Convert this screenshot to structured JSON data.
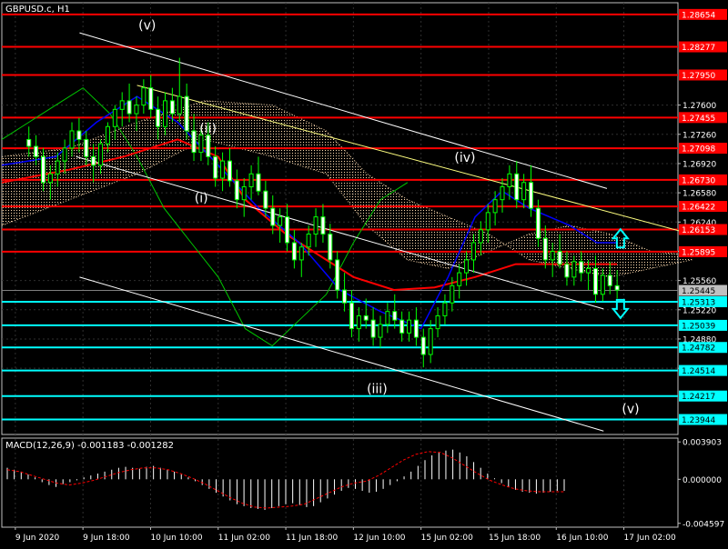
{
  "window": {
    "symbol_title": "GBPUSD.c, H1"
  },
  "indicator": {
    "macd_label": "MACD(12,26,9) -0.001183 -0.001282"
  },
  "colors": {
    "background": "#000000",
    "grid": "#2f2f2f",
    "candle": "#00ff00",
    "resistance": "#ff0000",
    "support": "#00ffff",
    "channel": "#ffffff",
    "trendline": "#ffff80",
    "ichimoku_cloud": "#ffdcb0",
    "kijun": "#ff0000",
    "tenkan": "#0000ff",
    "chikou": "#00c800",
    "macd_hist": "#ffffff",
    "macd_signal": "#ff0000",
    "badge_red": "#ff0000",
    "badge_cyan": "#00ffff",
    "badge_current": "#c0c0c0",
    "arrow_up": "#00ffff",
    "arrow_down": "#00ffff"
  },
  "chart_data": {
    "type": "candlestick",
    "symbol": "GBPUSD.c",
    "timeframe": "H1",
    "ylim": [
      1.2377,
      1.2879
    ],
    "xlim": [
      0,
      100
    ],
    "y_ticks": [
      "1.27600",
      "1.27260",
      "1.26920",
      "1.26580",
      "1.26240",
      "1.25900",
      "1.25560",
      "1.25220",
      "1.24880",
      "1.24540"
    ],
    "x_ticks": [
      {
        "label": "9 Jun 2020",
        "x": 2
      },
      {
        "label": "9 Jun 18:00",
        "x": 12
      },
      {
        "label": "10 Jun 10:00",
        "x": 22
      },
      {
        "label": "11 Jun 02:00",
        "x": 32
      },
      {
        "label": "11 Jun 18:00",
        "x": 42
      },
      {
        "label": "12 Jun 10:00",
        "x": 52
      },
      {
        "label": "15 Jun 02:00",
        "x": 62
      },
      {
        "label": "15 Jun 18:00",
        "x": 72
      },
      {
        "label": "16 Jun 10:00",
        "x": 82
      },
      {
        "label": "17 Jun 02:00",
        "x": 92
      }
    ],
    "current_price": "1.25445",
    "resistance_levels": [
      "1.28654",
      "1.28277",
      "1.27950",
      "1.27455",
      "1.27098",
      "1.26730",
      "1.26422",
      "1.26153",
      "1.25895"
    ],
    "support_levels": [
      "1.25313",
      "1.25039",
      "1.24782",
      "1.24514",
      "1.24217",
      "1.23944"
    ],
    "wave_labels": [
      {
        "text": "(v)",
        "x": 21.5,
        "y": 1.2848
      },
      {
        "text": "(ii)",
        "x": 30.5,
        "y": 1.2728
      },
      {
        "text": "(i)",
        "x": 29.5,
        "y": 1.2647
      },
      {
        "text": "(iv)",
        "x": 68.5,
        "y": 1.2694
      },
      {
        "text": "(iii)",
        "x": 55.5,
        "y": 1.2425
      },
      {
        "text": "(v)",
        "x": 93.0,
        "y": 1.2402
      }
    ],
    "channel_lines": [
      {
        "x1": 11.5,
        "y1": 1.2844,
        "x2": 89.5,
        "y2": 1.2663
      },
      {
        "x1": 11.0,
        "y1": 1.27,
        "x2": 89.0,
        "y2": 1.2523
      },
      {
        "x1": 11.5,
        "y1": 1.256,
        "x2": 89.0,
        "y2": 1.2381
      }
    ],
    "trend_line": {
      "x1": 20.0,
      "y1": 1.2783,
      "x2": 101.5,
      "y2": 1.2611
    },
    "signal_arrows": [
      {
        "direction": "up",
        "x": 91.5,
        "y": 1.2605
      },
      {
        "direction": "down",
        "x": 91.5,
        "y": 1.2523
      }
    ],
    "candles": [
      [
        1.272,
        1.2735,
        1.27,
        1.2712
      ],
      [
        1.2712,
        1.2725,
        1.269,
        1.27
      ],
      [
        1.27,
        1.271,
        1.266,
        1.267
      ],
      [
        1.267,
        1.269,
        1.265,
        1.268
      ],
      [
        1.268,
        1.2705,
        1.2665,
        1.2695
      ],
      [
        1.2695,
        1.272,
        1.268,
        1.271
      ],
      [
        1.271,
        1.274,
        1.27,
        1.273
      ],
      [
        1.273,
        1.2745,
        1.2705,
        1.272
      ],
      [
        1.272,
        1.273,
        1.269,
        1.27
      ],
      [
        1.27,
        1.2715,
        1.267,
        1.269
      ],
      [
        1.269,
        1.272,
        1.268,
        1.2715
      ],
      [
        1.2715,
        1.274,
        1.2705,
        1.2735
      ],
      [
        1.2735,
        1.276,
        1.272,
        1.2755
      ],
      [
        1.2755,
        1.2775,
        1.2735,
        1.2765
      ],
      [
        1.2765,
        1.2785,
        1.274,
        1.275
      ],
      [
        1.275,
        1.277,
        1.273,
        1.276
      ],
      [
        1.276,
        1.279,
        1.275,
        1.278
      ],
      [
        1.278,
        1.2795,
        1.2745,
        1.2755
      ],
      [
        1.2755,
        1.277,
        1.272,
        1.2735
      ],
      [
        1.2735,
        1.2775,
        1.2725,
        1.2765
      ],
      [
        1.2765,
        1.278,
        1.274,
        1.275
      ],
      [
        1.275,
        1.2815,
        1.274,
        1.277
      ],
      [
        1.277,
        1.2785,
        1.272,
        1.273
      ],
      [
        1.273,
        1.275,
        1.2695,
        1.2705
      ],
      [
        1.2705,
        1.2735,
        1.2695,
        1.2725
      ],
      [
        1.2725,
        1.274,
        1.269,
        1.27
      ],
      [
        1.27,
        1.2712,
        1.2665,
        1.2675
      ],
      [
        1.2675,
        1.2705,
        1.266,
        1.2695
      ],
      [
        1.2695,
        1.271,
        1.2665,
        1.2672
      ],
      [
        1.2672,
        1.2685,
        1.264,
        1.265
      ],
      [
        1.265,
        1.2675,
        1.263,
        1.2665
      ],
      [
        1.2665,
        1.269,
        1.265,
        1.268
      ],
      [
        1.268,
        1.27,
        1.2655,
        1.266
      ],
      [
        1.266,
        1.2672,
        1.263,
        1.264
      ],
      [
        1.264,
        1.2655,
        1.261,
        1.262
      ],
      [
        1.262,
        1.264,
        1.26,
        1.263
      ],
      [
        1.263,
        1.2645,
        1.259,
        1.26
      ],
      [
        1.26,
        1.2615,
        1.257,
        1.258
      ],
      [
        1.258,
        1.26,
        1.256,
        1.2595
      ],
      [
        1.2595,
        1.262,
        1.2585,
        1.261
      ],
      [
        1.261,
        1.264,
        1.2595,
        1.263
      ],
      [
        1.263,
        1.2645,
        1.26,
        1.261
      ],
      [
        1.261,
        1.2622,
        1.257,
        1.258
      ],
      [
        1.258,
        1.259,
        1.2535,
        1.2545
      ],
      [
        1.2545,
        1.2565,
        1.252,
        1.253
      ],
      [
        1.253,
        1.2545,
        1.249,
        1.25
      ],
      [
        1.25,
        1.2525,
        1.2485,
        1.2515
      ],
      [
        1.2515,
        1.2535,
        1.25,
        1.251
      ],
      [
        1.251,
        1.2525,
        1.248,
        1.249
      ],
      [
        1.249,
        1.2515,
        1.2478,
        1.2505
      ],
      [
        1.2505,
        1.253,
        1.2495,
        1.252
      ],
      [
        1.252,
        1.254,
        1.25,
        1.251
      ],
      [
        1.251,
        1.252,
        1.2485,
        1.2495
      ],
      [
        1.2495,
        1.252,
        1.2485,
        1.251
      ],
      [
        1.251,
        1.2525,
        1.248,
        1.249
      ],
      [
        1.249,
        1.25,
        1.2455,
        1.247
      ],
      [
        1.247,
        1.251,
        1.246,
        1.25
      ],
      [
        1.25,
        1.2525,
        1.249,
        1.2515
      ],
      [
        1.2515,
        1.254,
        1.2505,
        1.253
      ],
      [
        1.253,
        1.256,
        1.252,
        1.255
      ],
      [
        1.255,
        1.2575,
        1.2535,
        1.2565
      ],
      [
        1.2565,
        1.259,
        1.255,
        1.258
      ],
      [
        1.258,
        1.261,
        1.2565,
        1.26
      ],
      [
        1.26,
        1.2625,
        1.2585,
        1.2615
      ],
      [
        1.2615,
        1.2645,
        1.26,
        1.2635
      ],
      [
        1.2635,
        1.266,
        1.262,
        1.265
      ],
      [
        1.265,
        1.2675,
        1.2635,
        1.2665
      ],
      [
        1.2665,
        1.269,
        1.265,
        1.268
      ],
      [
        1.268,
        1.2695,
        1.264,
        1.265
      ],
      [
        1.265,
        1.268,
        1.264,
        1.267
      ],
      [
        1.267,
        1.269,
        1.263,
        1.264
      ],
      [
        1.264,
        1.265,
        1.2595,
        1.2605
      ],
      [
        1.2605,
        1.262,
        1.257,
        1.258
      ],
      [
        1.258,
        1.26,
        1.256,
        1.259
      ],
      [
        1.259,
        1.261,
        1.257,
        1.2575
      ],
      [
        1.2575,
        1.259,
        1.255,
        1.256
      ],
      [
        1.256,
        1.2585,
        1.255,
        1.2578
      ],
      [
        1.2578,
        1.259,
        1.2555,
        1.2565
      ],
      [
        1.2565,
        1.258,
        1.2545,
        1.257
      ],
      [
        1.257,
        1.2585,
        1.253,
        1.254
      ],
      [
        1.254,
        1.257,
        1.2532,
        1.2562
      ],
      [
        1.2562,
        1.2578,
        1.254,
        1.255
      ],
      [
        1.255,
        1.2568,
        1.2535,
        1.2545
      ]
    ],
    "ichimoku": {
      "tenkan": [
        [
          0,
          1.269
        ],
        [
          8,
          1.27
        ],
        [
          14,
          1.274
        ],
        [
          20,
          1.277
        ],
        [
          26,
          1.274
        ],
        [
          32,
          1.269
        ],
        [
          38,
          1.264
        ],
        [
          44,
          1.26
        ],
        [
          50,
          1.2545
        ],
        [
          56,
          1.252
        ],
        [
          62,
          1.25
        ],
        [
          66,
          1.256
        ],
        [
          70,
          1.263
        ],
        [
          74,
          1.266
        ],
        [
          78,
          1.264
        ],
        [
          84,
          1.262
        ],
        [
          88,
          1.26
        ],
        [
          91,
          1.26
        ]
      ],
      "kijun": [
        [
          0,
          1.267
        ],
        [
          10,
          1.2685
        ],
        [
          18,
          1.27
        ],
        [
          26,
          1.272
        ],
        [
          32,
          1.27
        ],
        [
          36,
          1.265
        ],
        [
          42,
          1.261
        ],
        [
          48,
          1.258
        ],
        [
          52,
          1.256
        ],
        [
          58,
          1.2545
        ],
        [
          64,
          1.2548
        ],
        [
          70,
          1.256
        ],
        [
          76,
          1.2575
        ],
        [
          84,
          1.2575
        ],
        [
          91,
          1.2575
        ]
      ],
      "chikou": [
        [
          0,
          1.272
        ],
        [
          4,
          1.274
        ],
        [
          8,
          1.276
        ],
        [
          12,
          1.278
        ],
        [
          16,
          1.275
        ],
        [
          20,
          1.27
        ],
        [
          24,
          1.264
        ],
        [
          28,
          1.26
        ],
        [
          32,
          1.256
        ],
        [
          36,
          1.25
        ],
        [
          40,
          1.248
        ],
        [
          44,
          1.251
        ],
        [
          48,
          1.254
        ],
        [
          52,
          1.26
        ],
        [
          56,
          1.265
        ],
        [
          60,
          1.267
        ]
      ],
      "span_a": [
        [
          0,
          1.262
        ],
        [
          10,
          1.265
        ],
        [
          20,
          1.268
        ],
        [
          30,
          1.272
        ],
        [
          40,
          1.27
        ],
        [
          48,
          1.268
        ],
        [
          54,
          1.262
        ],
        [
          60,
          1.258
        ],
        [
          66,
          1.257
        ],
        [
          72,
          1.259
        ],
        [
          78,
          1.261
        ],
        [
          84,
          1.262
        ],
        [
          90,
          1.261
        ],
        [
          96,
          1.259
        ],
        [
          102,
          1.2585
        ]
      ],
      "span_b": [
        [
          0,
          1.27
        ],
        [
          10,
          1.271
        ],
        [
          20,
          1.274
        ],
        [
          30,
          1.2765
        ],
        [
          40,
          1.276
        ],
        [
          48,
          1.273
        ],
        [
          54,
          1.268
        ],
        [
          60,
          1.265
        ],
        [
          66,
          1.263
        ],
        [
          72,
          1.261
        ],
        [
          78,
          1.258
        ],
        [
          84,
          1.257
        ],
        [
          90,
          1.256
        ],
        [
          96,
          1.257
        ],
        [
          102,
          1.258
        ]
      ]
    },
    "macd": {
      "ylim": [
        -0.005,
        0.0043
      ],
      "y_ticks": [
        "0.003903",
        "0.000000",
        "-0.004597"
      ],
      "histogram": [
        0.0012,
        0.001,
        0.0008,
        0.0005,
        0.0002,
        -0.0003,
        -0.0006,
        -0.0008,
        -0.0005,
        -0.0003,
        -0.0001,
        0.0002,
        0.0004,
        0.0006,
        0.0008,
        0.001,
        0.0012,
        0.0013,
        0.0012,
        0.0011,
        0.0013,
        0.0014,
        0.0012,
        0.001,
        0.0008,
        0.0005,
        0.0002,
        -0.0002,
        -0.0006,
        -0.001,
        -0.0014,
        -0.0018,
        -0.0022,
        -0.0026,
        -0.0028,
        -0.003,
        -0.0031,
        -0.0032,
        -0.003,
        -0.0028,
        -0.0026,
        -0.0025,
        -0.0027,
        -0.0029,
        -0.0028,
        -0.0024,
        -0.002,
        -0.0016,
        -0.0012,
        -0.0009,
        -0.001,
        -0.0012,
        -0.0014,
        -0.0013,
        -0.001,
        -0.0006,
        -0.0002,
        0.0003,
        0.0008,
        0.0014,
        0.002,
        0.0025,
        0.0028,
        0.003,
        0.0031,
        0.0028,
        0.0024,
        0.0018,
        0.0012,
        0.0006,
        0.0001,
        -0.0004,
        -0.0008,
        -0.0011,
        -0.0013,
        -0.0014,
        -0.0015,
        -0.0014,
        -0.0013,
        -0.0012,
        -0.0012
      ],
      "signal": [
        0.001,
        0.0008,
        0.0004,
        0.0,
        -0.0004,
        -0.0006,
        -0.0004,
        -0.0001,
        0.0003,
        0.0007,
        0.001,
        0.0012,
        0.0012,
        0.001,
        0.0006,
        0.0001,
        -0.0005,
        -0.0012,
        -0.0019,
        -0.0025,
        -0.0029,
        -0.003,
        -0.0029,
        -0.0028,
        -0.0026,
        -0.002,
        -0.0014,
        -0.0008,
        -0.0004,
        -0.0002,
        0.0004,
        0.0012,
        0.002,
        0.0026,
        0.0029,
        0.0028,
        0.0022,
        0.0014,
        0.0006,
        -0.0001,
        -0.0006,
        -0.001,
        -0.0012,
        -0.0013,
        -0.0013,
        -0.0013
      ]
    }
  }
}
